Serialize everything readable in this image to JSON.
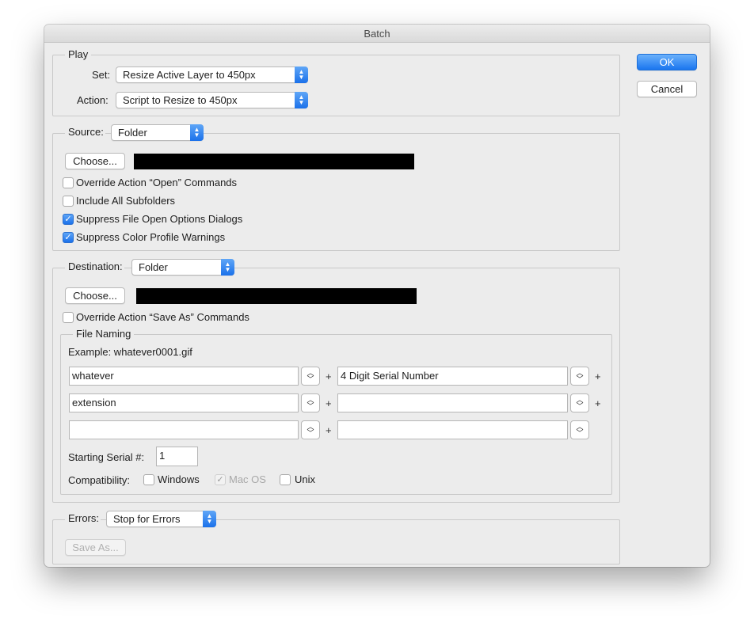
{
  "window": {
    "title": "Batch"
  },
  "buttons": {
    "ok": "OK",
    "cancel": "Cancel"
  },
  "play": {
    "legend": "Play",
    "set_label": "Set:",
    "set_value": "Resize Active Layer to 450px",
    "action_label": "Action:",
    "action_value": "Script to Resize to 450px"
  },
  "source": {
    "label": "Source:",
    "value": "Folder",
    "choose": "Choose...",
    "options": [
      {
        "label": "Override Action “Open” Commands",
        "checked": false
      },
      {
        "label": "Include All Subfolders",
        "checked": false
      },
      {
        "label": "Suppress File Open Options Dialogs",
        "checked": true
      },
      {
        "label": "Suppress Color Profile Warnings",
        "checked": true
      }
    ]
  },
  "destination": {
    "label": "Destination:",
    "value": "Folder",
    "choose": "Choose...",
    "override_label": "Override Action “Save As” Commands"
  },
  "file_naming": {
    "legend": "File Naming",
    "example": "Example: whatever0001.gif",
    "rows": [
      {
        "left": "whatever",
        "right": "4 Digit Serial Number"
      },
      {
        "left": "extension",
        "right": ""
      },
      {
        "left": "",
        "right": ""
      }
    ],
    "plus": "+",
    "serial_label": "Starting Serial #:",
    "serial_value": "1",
    "compat_label": "Compatibility:",
    "compat": [
      {
        "label": "Windows",
        "checked": false
      },
      {
        "label": "Mac OS",
        "checked": true,
        "disabled": true
      },
      {
        "label": "Unix",
        "checked": false
      }
    ]
  },
  "errors": {
    "label": "Errors:",
    "value": "Stop for Errors",
    "save_as": "Save As..."
  },
  "icons": {
    "popup_arrow": "⌃⌄",
    "check": "✓"
  },
  "colors": {
    "accent": "#1b71ea",
    "window": "#ececec"
  }
}
